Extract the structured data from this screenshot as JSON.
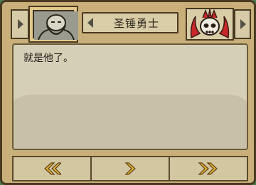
{
  "header": {
    "speaker_name": "圣锤勇士",
    "left_portrait_icon": "bearded-warrior-portrait-icon",
    "right_portrait_icon": "horned-skull-portrait-icon"
  },
  "dialog": {
    "text": "就是他了。"
  },
  "controls": {
    "back_icon": "double-chevron-left-icon",
    "next_icon": "chevron-right-icon",
    "skip_icon": "double-chevron-right-icon"
  },
  "colors": {
    "frame": "#c9b07a",
    "accent_gold": "#e0b13a",
    "skull_red": "#c8282a"
  }
}
